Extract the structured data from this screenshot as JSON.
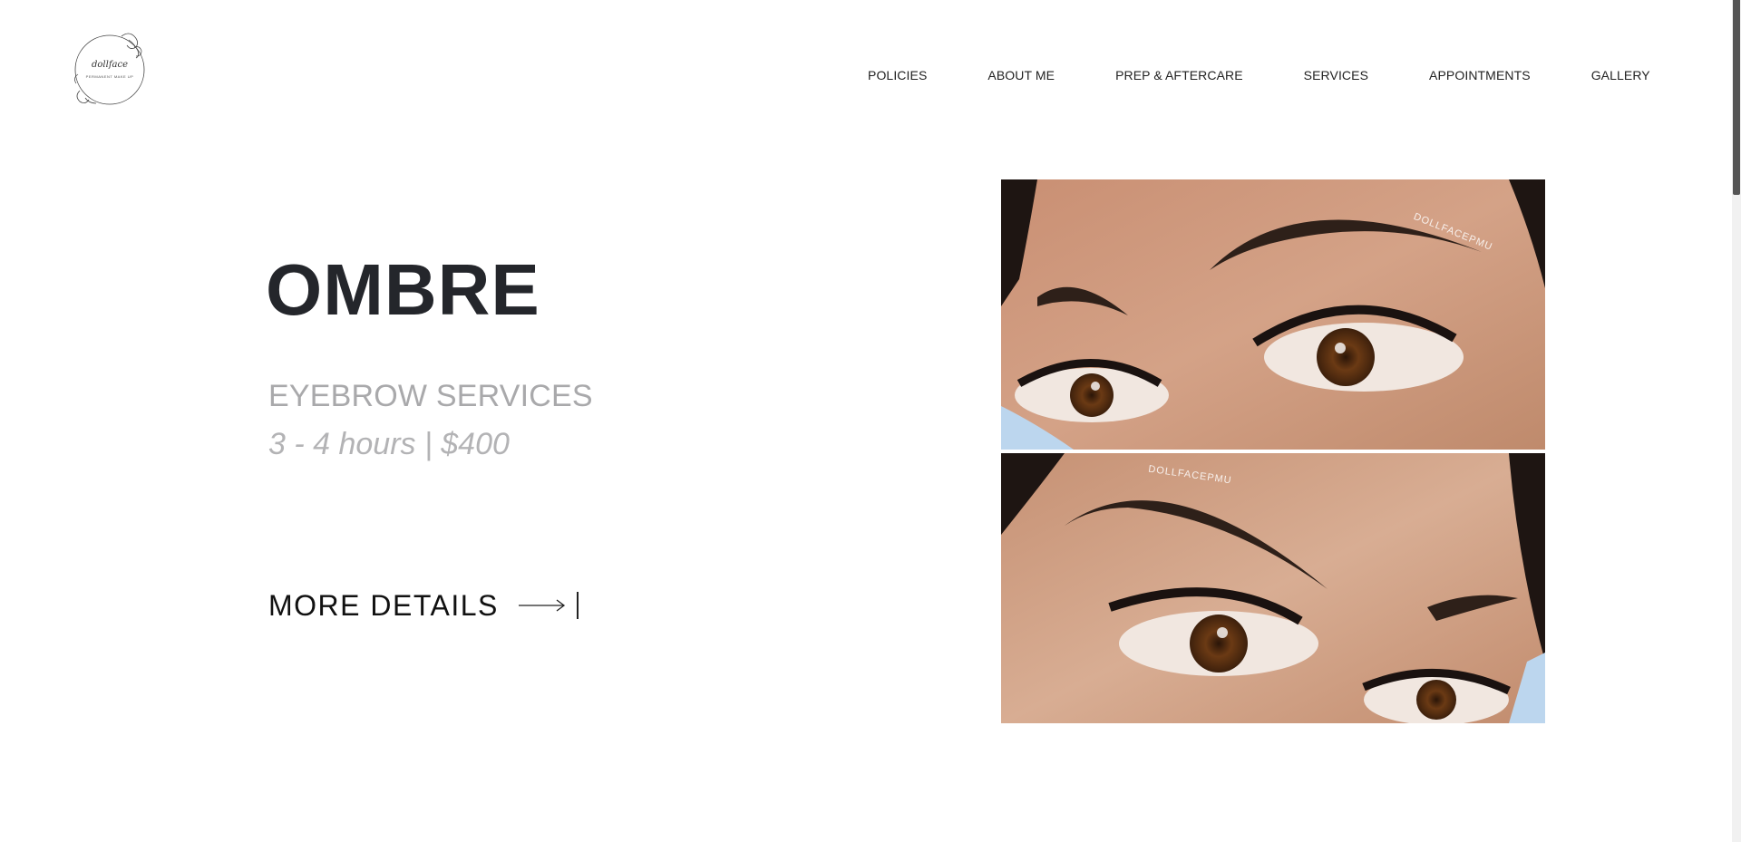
{
  "brand": {
    "logo_script": "dollface",
    "logo_sub": "PERMANENT MAKE UP"
  },
  "nav": {
    "items": [
      {
        "label": "POLICIES"
      },
      {
        "label": "ABOUT ME"
      },
      {
        "label": "PREP & AFTERCARE"
      },
      {
        "label": "SERVICES"
      },
      {
        "label": "APPOINTMENTS"
      },
      {
        "label": "GALLERY"
      }
    ]
  },
  "hero": {
    "title": "OMBRE",
    "subtitle": "EYEBROW SERVICES",
    "meta": "3 - 4 hours | $400",
    "cta_label": "MORE DETAILS"
  },
  "photo": {
    "watermark": "DOLLFACEPMU"
  },
  "colors": {
    "title": "#24262b",
    "subtitle": "#a9a9ab",
    "text": "#111111",
    "skin": "#c9977a",
    "brow": "#3a2a22"
  }
}
